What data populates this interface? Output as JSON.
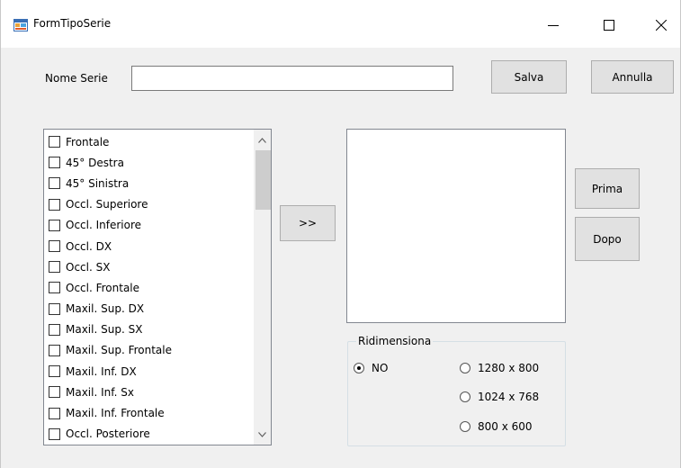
{
  "window": {
    "title": "FormTipoSerie",
    "minimize_icon": "minimize-icon",
    "maximize_icon": "maximize-icon",
    "close_icon": "close-icon"
  },
  "form": {
    "nome_serie_label": "Nome Serie",
    "nome_serie_value": "",
    "salva_label": "Salva",
    "annulla_label": "Annulla",
    "move_label": ">>",
    "prima_label": "Prima",
    "dopo_label": "Dopo"
  },
  "source_list": {
    "items": [
      {
        "label": "Frontale",
        "checked": false
      },
      {
        "label": "45° Destra",
        "checked": false
      },
      {
        "label": "45° Sinistra",
        "checked": false
      },
      {
        "label": "Occl. Superiore",
        "checked": false
      },
      {
        "label": "Occl. Inferiore",
        "checked": false
      },
      {
        "label": "Occl. DX",
        "checked": false
      },
      {
        "label": "Occl. SX",
        "checked": false
      },
      {
        "label": "Occl. Frontale",
        "checked": false
      },
      {
        "label": "Maxil. Sup. DX",
        "checked": false
      },
      {
        "label": "Maxil. Sup. SX",
        "checked": false
      },
      {
        "label": "Maxil. Sup. Frontale",
        "checked": false
      },
      {
        "label": "Maxil. Inf. DX",
        "checked": false
      },
      {
        "label": "Maxil. Inf. Sx",
        "checked": false
      },
      {
        "label": "Maxil. Inf. Frontale",
        "checked": false
      },
      {
        "label": "Occl. Posteriore",
        "checked": false
      }
    ]
  },
  "target_list": {
    "items": []
  },
  "ridimensiona": {
    "legend": "Ridimensiona",
    "options": [
      {
        "label": "NO",
        "checked": true
      },
      {
        "label": "1280 x 800",
        "checked": false
      },
      {
        "label": "1024 x 768",
        "checked": false
      },
      {
        "label": "800 x 600",
        "checked": false
      }
    ]
  },
  "colors": {
    "window_bg": "#f0f0f0",
    "button_bg": "#e1e1e1",
    "button_border": "#adadad"
  }
}
